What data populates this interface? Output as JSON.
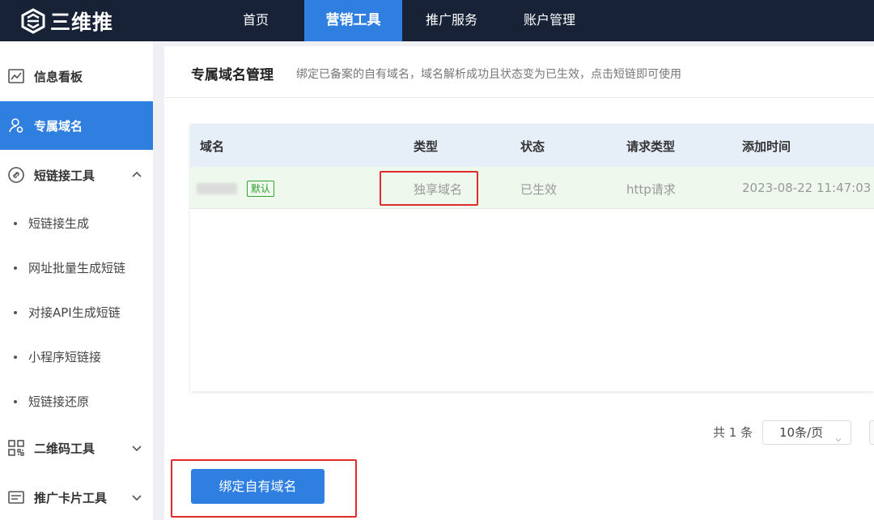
{
  "brand": {
    "name": "三维推"
  },
  "nav": {
    "items": [
      {
        "label": "首页"
      },
      {
        "label": "营销工具"
      },
      {
        "label": "推广服务"
      },
      {
        "label": "账户管理"
      }
    ]
  },
  "sidebar": {
    "items": [
      {
        "label": "信息看板"
      },
      {
        "label": "专属域名"
      },
      {
        "label": "短链接工具"
      },
      {
        "label": "二维码工具"
      },
      {
        "label": "推广卡片工具"
      }
    ],
    "sub_items": [
      {
        "label": "短链接生成"
      },
      {
        "label": "网址批量生成短链"
      },
      {
        "label": "对接API生成短链"
      },
      {
        "label": "小程序短链接"
      },
      {
        "label": "短链接还原"
      }
    ]
  },
  "page": {
    "title": "专属域名管理",
    "description": "绑定已备案的自有域名，域名解析成功且状态变为已生效，点击短链即可使用"
  },
  "table": {
    "columns": [
      "域名",
      "类型",
      "状态",
      "请求类型",
      "添加时间"
    ],
    "rows": [
      {
        "badge": "默认",
        "type": "独享域名",
        "status": "已生效",
        "request_type": "http请求",
        "added_time": "2023-08-22 11:47:03"
      }
    ]
  },
  "pagination": {
    "total": "共 1 条",
    "page_size": "10条/页"
  },
  "actions": {
    "bind_button": "绑定自有域名"
  },
  "colors": {
    "primary": "#2f7fe0",
    "topbar": "#172237",
    "highlight": "#e02b2b"
  }
}
